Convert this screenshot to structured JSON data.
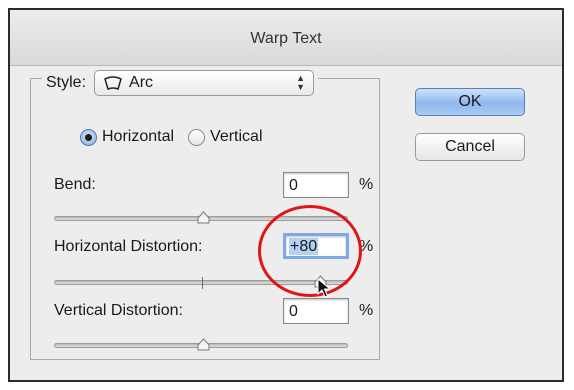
{
  "dialog": {
    "title": "Warp Text",
    "style_label": "Style:",
    "style_value": "Arc",
    "style_icon": "arc-warp-icon",
    "orientation": {
      "horizontal_label": "Horizontal",
      "vertical_label": "Vertical",
      "selected": "Horizontal"
    },
    "bend": {
      "label": "Bend:",
      "value": "0",
      "unit": "%",
      "slider_fraction": 0.5
    },
    "horizontal_distortion": {
      "label": "Horizontal Distortion:",
      "value": "+80",
      "unit": "%",
      "slider_fraction": 0.9
    },
    "vertical_distortion": {
      "label": "Vertical Distortion:",
      "value": "0",
      "unit": "%",
      "slider_fraction": 0.5
    },
    "buttons": {
      "ok": "OK",
      "cancel": "Cancel"
    },
    "colors": {
      "highlight_circle": "#e01515",
      "focus_ring": "#7fa8e6",
      "default_button": "#8fb8ee"
    }
  }
}
